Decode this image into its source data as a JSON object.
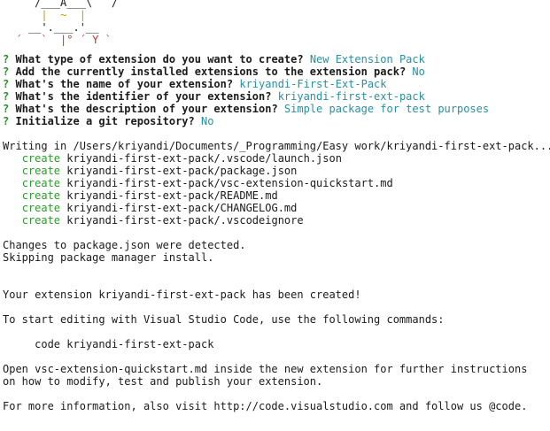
{
  "ascii_art": [
    {
      "text": "     /___A___\\   /",
      "red": ""
    },
    {
      "text": "      |  ~  |",
      "red": ""
    },
    {
      "text": "    __'.___.'__",
      "red": ""
    },
    {
      "text": "  ´   `  |° ´ Y `",
      "red": ""
    }
  ],
  "questions": [
    {
      "mark": "?",
      "text": "What type of extension do you want to create?",
      "answer": "New Extension Pack"
    },
    {
      "mark": "?",
      "text": "Add the currently installed extensions to the extension pack?",
      "answer": "No"
    },
    {
      "mark": "?",
      "text": "What's the name of your extension?",
      "answer": "kriyandi-First-Ext-Pack"
    },
    {
      "mark": "?",
      "text": "What's the identifier of your extension?",
      "answer": "kriyandi-first-ext-pack"
    },
    {
      "mark": "?",
      "text": "What's the description of your extension?",
      "answer": "Simple package for test purposes"
    },
    {
      "mark": "?",
      "text": "Initialize a git repository?",
      "answer": "No"
    }
  ],
  "writing_line": "Writing in /Users/kriyandi/Documents/_Programming/Easy work/kriyandi-first-ext-pack...",
  "creates": [
    {
      "verb": "create",
      "path": "kriyandi-first-ext-pack/.vscode/launch.json"
    },
    {
      "verb": "create",
      "path": "kriyandi-first-ext-pack/package.json"
    },
    {
      "verb": "create",
      "path": "kriyandi-first-ext-pack/vsc-extension-quickstart.md"
    },
    {
      "verb": "create",
      "path": "kriyandi-first-ext-pack/README.md"
    },
    {
      "verb": "create",
      "path": "kriyandi-first-ext-pack/CHANGELOG.md"
    },
    {
      "verb": "create",
      "path": "kriyandi-first-ext-pack/.vscodeignore"
    }
  ],
  "changes_detected": "Changes to package.json were detected.",
  "skipping": "Skipping package manager install.",
  "created": "Your extension kriyandi-first-ext-pack has been created!",
  "start_editing": "To start editing with Visual Studio Code, use the following commands:",
  "code_cmd": "     code kriyandi-first-ext-pack",
  "open_line1": "Open vsc-extension-quickstart.md inside the new extension for further instructions",
  "open_line2": "on how to modify, test and publish your extension.",
  "more_info": "For more information, also visit http://code.visualstudio.com and follow us @code."
}
